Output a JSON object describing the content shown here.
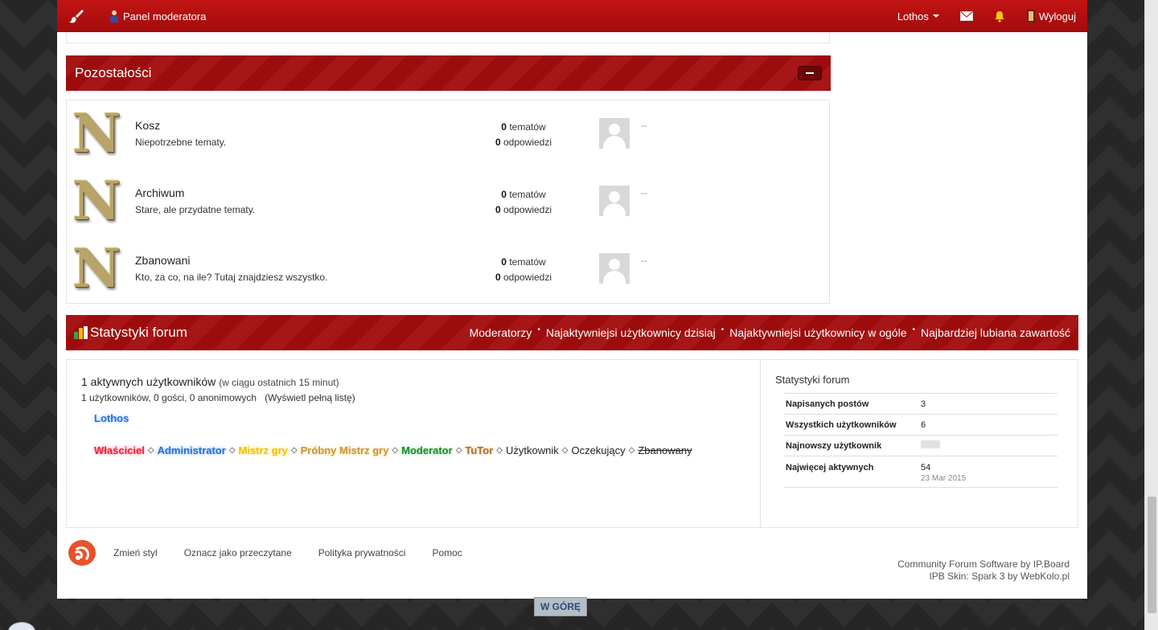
{
  "topbar": {
    "mod_panel": "Panel moderatora",
    "user": "Lothos",
    "logout": "Wyloguj"
  },
  "category": {
    "title": "Pozostałości",
    "forums": [
      {
        "name": "Kosz",
        "desc": "Niepotrzebne tematy.",
        "topics_count": "0",
        "topics_label": "tematów",
        "replies_count": "0",
        "replies_label": "odpowiedzi",
        "last_post": "--"
      },
      {
        "name": "Archiwum",
        "desc": "Stare, ale przydatne tematy.",
        "topics_count": "0",
        "topics_label": "tematów",
        "replies_count": "0",
        "replies_label": "odpowiedzi",
        "last_post": "--"
      },
      {
        "name": "Zbanowani",
        "desc": "Kto, za co, na ile? Tutaj znajdziesz wszystko.",
        "topics_count": "0",
        "topics_label": "tematów",
        "replies_count": "0",
        "replies_label": "odpowiedzi",
        "last_post": "--"
      }
    ],
    "logo_letter": "N"
  },
  "stats": {
    "title": "Statystyki forum",
    "links": [
      "Moderatorzy",
      "Najaktywniejsi użytkownicy dzisiaj",
      "Najaktywniejsi użytkownicy w ogóle",
      "Najbardziej lubiana zawartość"
    ],
    "link_sep": "•",
    "active_title": "1 aktywnych użytkowników",
    "active_title_note": "(w ciągu ostatnich 15 minut)",
    "active_sub": "1 użytkowników, 0 gości, 0 anonimowych",
    "active_sub_link": "(Wyświetl pełną listę)",
    "active_user": "Lothos",
    "legend_sep": "◇",
    "groups": [
      {
        "name": "Właściciel",
        "color": "#e8203a",
        "glow": "rgba(255,60,80,0.7)",
        "bold": true,
        "strike": false
      },
      {
        "name": "Administrator",
        "color": "#2a6fd4",
        "glow": "rgba(70,150,255,0.7)",
        "bold": true,
        "strike": false
      },
      {
        "name": "Mistrz gry",
        "color": "#f2c200",
        "glow": "rgba(255,210,40,0.7)",
        "bold": true,
        "strike": false
      },
      {
        "name": "Próbny Mistrz gry",
        "color": "#c9962e",
        "glow": "rgba(230,180,80,0.6)",
        "bold": true,
        "strike": false
      },
      {
        "name": "Moderator",
        "color": "#1c8a2e",
        "glow": "rgba(60,200,80,0.6)",
        "bold": true,
        "strike": false
      },
      {
        "name": "TuTor",
        "color": "#a8732a",
        "glow": "rgba(200,140,60,0.6)",
        "bold": true,
        "strike": false
      },
      {
        "name": "Użytkownik",
        "color": "#222222",
        "glow": "transparent",
        "bold": false,
        "strike": false
      },
      {
        "name": "Oczekujący",
        "color": "#222222",
        "glow": "transparent",
        "bold": false,
        "strike": false
      },
      {
        "name": "Zbanowany",
        "color": "#222222",
        "glow": "transparent",
        "bold": false,
        "strike": true
      }
    ],
    "side_title": "Statystyki forum",
    "side_rows": [
      {
        "key": "Napisanych postów",
        "value": "3"
      },
      {
        "key": "Wszystkich użytkowników",
        "value": "6"
      },
      {
        "key": "Najnowszy użytkownik",
        "value": ""
      },
      {
        "key": "Najwięcej aktywnych",
        "value": "54",
        "note": "23 Mar 2015"
      }
    ]
  },
  "footer": {
    "links": [
      "Zmień styl",
      "Oznacz jako przeczytane",
      "Polityka prywatności",
      "Pomoc"
    ],
    "credit1": "Community Forum Software by IP.Board",
    "credit2": "IPB Skin: Spark 3 by WebKolo.pl",
    "go_top": "W GÓRĘ"
  },
  "colors": {
    "accent": "#a30d0d",
    "link_blue": "#2a6fd4"
  }
}
